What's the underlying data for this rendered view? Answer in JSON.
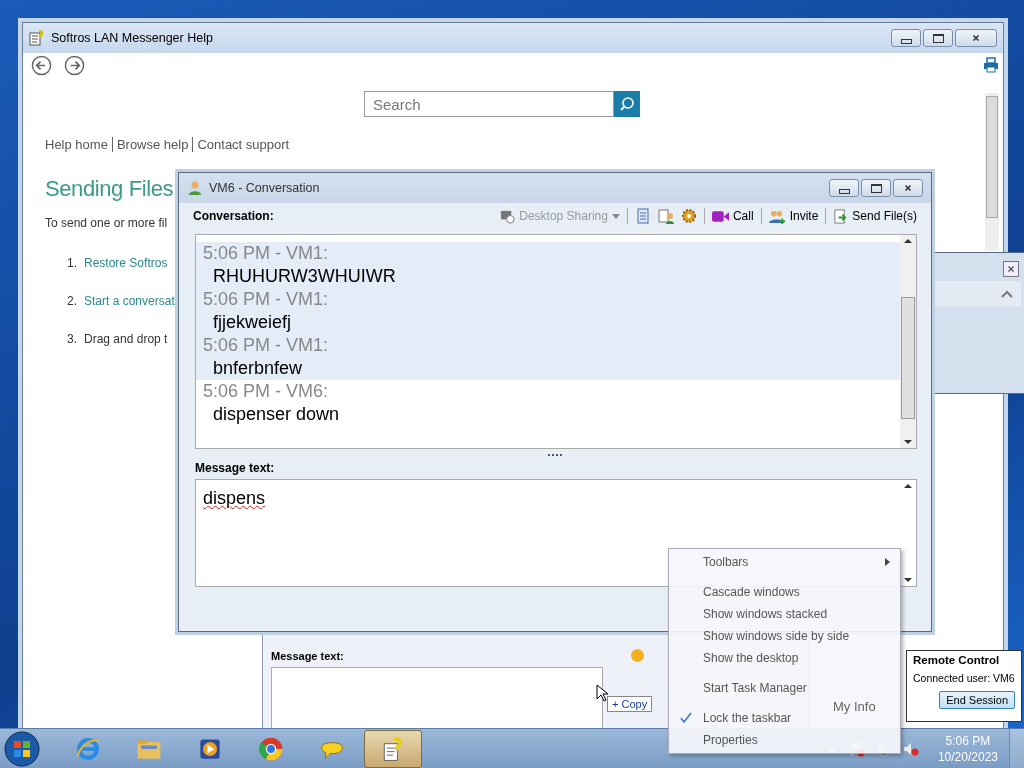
{
  "help_window": {
    "title": "Softros LAN Messenger Help",
    "search": {
      "placeholder": "Search"
    },
    "nav_links": [
      "Help home",
      "Browse help",
      "Contact support"
    ],
    "heading": "Sending Files",
    "intro": "To send one or more fil",
    "steps": [
      {
        "number": "1.",
        "text": "Restore Softros",
        "link": true
      },
      {
        "number": "2.",
        "text": "Start a conversat",
        "link": true
      },
      {
        "number": "3.",
        "text": "Drag and drop t",
        "link": false
      }
    ]
  },
  "conversation_window": {
    "title": "VM6 - Conversation",
    "conversation_label": "Conversation:",
    "toolbar": {
      "desktop_sharing": {
        "label": "Desktop Sharing",
        "disabled": true
      },
      "call": {
        "label": "Call"
      },
      "invite": {
        "label": "Invite"
      },
      "send_files": {
        "label": "Send File(s)"
      }
    },
    "messages": [
      {
        "header": "5:06 PM - VM1:",
        "text": "RHUHURW3WHUIWR",
        "highlighted": true
      },
      {
        "header": "5:06 PM - VM1:",
        "text": "fjjekweiefj",
        "highlighted": true
      },
      {
        "header": "5:06 PM - VM1:",
        "text": "bnferbnfew",
        "highlighted": true
      },
      {
        "header": "5:06 PM - VM6:",
        "text": "dispenser down",
        "highlighted": false
      }
    ],
    "message_label": "Message text:",
    "message_value": "dispens"
  },
  "back_window": {
    "message_label": "Message text:",
    "my_info": "My Info"
  },
  "drag_tooltip": "+ Copy",
  "context_menu": {
    "groups": [
      [
        {
          "label": "Toolbars",
          "kind": "submenu",
          "checked": false
        }
      ],
      [
        {
          "label": "Cascade windows",
          "kind": "item",
          "checked": false
        },
        {
          "label": "Show windows stacked",
          "kind": "item",
          "checked": false
        },
        {
          "label": "Show windows side by side",
          "kind": "item",
          "checked": false
        },
        {
          "label": "Show the desktop",
          "kind": "item",
          "checked": false
        }
      ],
      [
        {
          "label": "Start Task Manager",
          "kind": "item",
          "checked": false
        }
      ],
      [
        {
          "label": "Lock the taskbar",
          "kind": "item",
          "checked": true
        },
        {
          "label": "Properties",
          "kind": "item",
          "checked": false
        }
      ]
    ]
  },
  "remote_control": {
    "title": "Remote Control",
    "connected": "Connected user: VM6",
    "button": "End Session"
  },
  "taskbar": {
    "buttons": [
      {
        "active": false
      },
      {
        "active": false
      },
      {
        "active": false
      },
      {
        "active": false
      },
      {
        "active": false
      },
      {
        "active": true
      }
    ],
    "time": "5:06 PM",
    "date": "10/20/2023"
  }
}
